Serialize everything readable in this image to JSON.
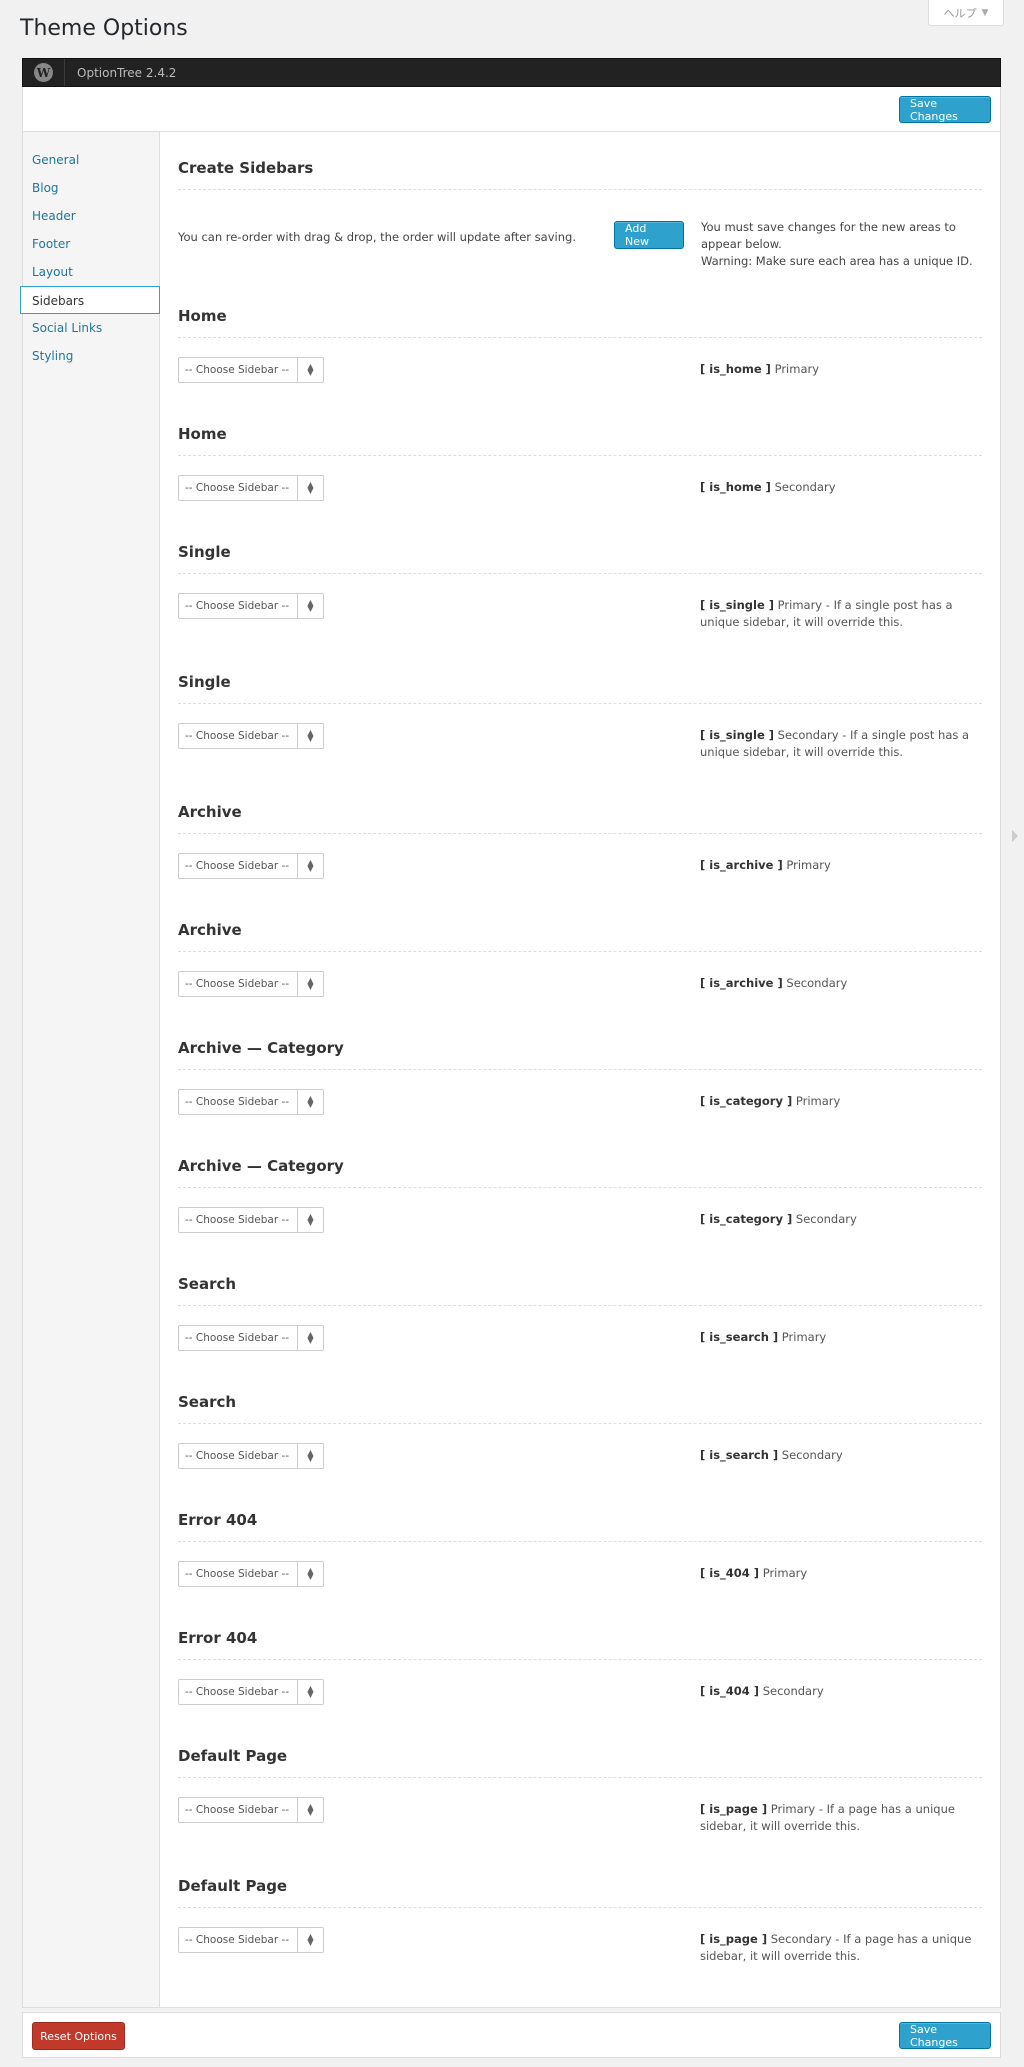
{
  "help": {
    "label": "ヘルプ",
    "arrow": "▼"
  },
  "page_title": "Theme Options",
  "header": {
    "version": "OptionTree 2.4.2",
    "logo_glyph": "W"
  },
  "toolbar": {
    "save_label": "Save Changes"
  },
  "nav": {
    "items": [
      {
        "label": "General"
      },
      {
        "label": "Blog"
      },
      {
        "label": "Header"
      },
      {
        "label": "Footer"
      },
      {
        "label": "Layout"
      },
      {
        "label": "Sidebars",
        "active": true
      },
      {
        "label": "Social Links"
      },
      {
        "label": "Styling"
      }
    ]
  },
  "create": {
    "title": "Create Sidebars",
    "text": "You can re-order with drag & drop, the order will update after saving.",
    "add_label": "Add New",
    "note_1": "You must save changes for the new areas to appear below.",
    "note_2": "Warning: Make sure each area has a unique ID."
  },
  "select_placeholder": "-- Choose Sidebar --",
  "options": [
    {
      "title": "Home",
      "cond": "[ is_home ]",
      "text": " Primary"
    },
    {
      "title": "Home",
      "cond": "[ is_home ]",
      "text": " Secondary"
    },
    {
      "title": "Single",
      "cond": "[ is_single ]",
      "text": " Primary - If a single post has a unique sidebar, it will override this."
    },
    {
      "title": "Single",
      "cond": "[ is_single ]",
      "text": " Secondary - If a single post has a unique sidebar, it will override this."
    },
    {
      "title": "Archive",
      "cond": "[ is_archive ]",
      "text": " Primary"
    },
    {
      "title": "Archive",
      "cond": "[ is_archive ]",
      "text": " Secondary"
    },
    {
      "title": "Archive — Category",
      "cond": "[ is_category ]",
      "text": " Primary"
    },
    {
      "title": "Archive — Category",
      "cond": "[ is_category ]",
      "text": " Secondary"
    },
    {
      "title": "Search",
      "cond": "[ is_search ]",
      "text": " Primary"
    },
    {
      "title": "Search",
      "cond": "[ is_search ]",
      "text": " Secondary"
    },
    {
      "title": "Error 404",
      "cond": "[ is_404 ]",
      "text": " Primary"
    },
    {
      "title": "Error 404",
      "cond": "[ is_404 ]",
      "text": " Secondary"
    },
    {
      "title": "Default Page",
      "cond": "[ is_page ]",
      "text": " Primary - If a page has a unique sidebar, it will override this."
    },
    {
      "title": "Default Page",
      "cond": "[ is_page ]",
      "text": " Secondary - If a page has a unique sidebar, it will override this."
    }
  ],
  "footer": {
    "reset_label": "Reset Options",
    "save_label": "Save Changes"
  }
}
